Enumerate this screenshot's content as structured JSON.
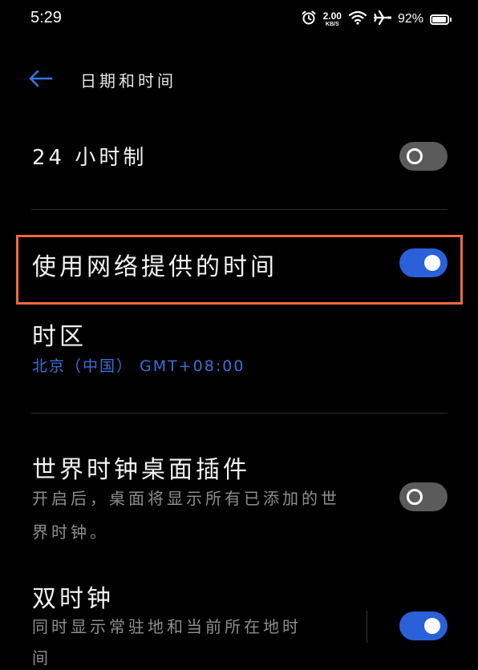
{
  "status_bar": {
    "time": "5:29",
    "net_speed_value": "2.00",
    "net_speed_unit": "KB/S",
    "battery_percent": "92%",
    "battery_level": 0.92,
    "icons": [
      "alarm-icon",
      "wifi-icon",
      "airplane-mode-icon",
      "battery-icon"
    ]
  },
  "header": {
    "back_icon": "back-arrow-icon",
    "title": "日期和时间"
  },
  "settings": {
    "hour24": {
      "label": "24 小时制",
      "enabled": false
    },
    "network_time": {
      "label": "使用网络提供的时间",
      "enabled": true
    },
    "timezone": {
      "label": "时区",
      "value": "北京（中国） GMT+08:00"
    },
    "world_clock_widget": {
      "label": "世界时钟桌面插件",
      "desc_line1": "开启后，桌面将显示所有已添加的世",
      "desc_line2": "界时钟。",
      "enabled": false
    },
    "dual_clock": {
      "label": "双时钟",
      "desc_line1": "同时显示常驻地和当前所在地时",
      "desc_line2": "间",
      "enabled": true
    }
  },
  "colors": {
    "background": "#000000",
    "accent": "#2a61d9",
    "link_text": "#3b6fd8",
    "toggle_off": "#5b5b5b",
    "highlight": "#f06a3c"
  }
}
